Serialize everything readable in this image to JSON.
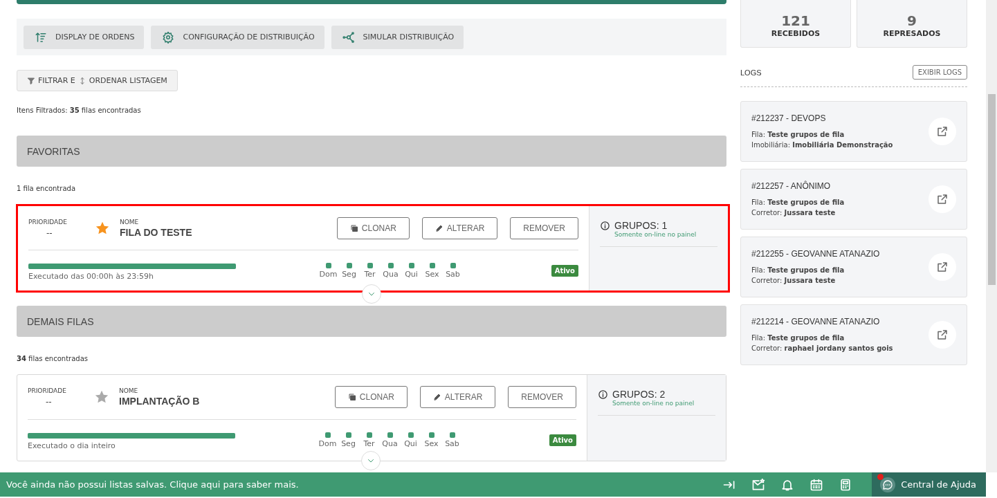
{
  "toolbar": [
    {
      "kind": "sort",
      "label": "DISPLAY DE ORDENS"
    },
    {
      "kind": "gear",
      "label": "CONFIGURAÇÃO DE DISTRIBUIÇÃO"
    },
    {
      "kind": "network",
      "label": "SIMULAR DISTRIBUIÇÃO"
    }
  ],
  "filter_button": {
    "part1": "FILTRAR E",
    "part2": "ORDENAR LISTAGEM"
  },
  "filtered_summary": "Itens Filtrados: **35** filas encontradas",
  "sections": [
    {
      "title": "FAVORITAS",
      "count_text": "1 fila encontrada",
      "queues": [
        {
          "priority_label": "PRIORIDADE",
          "priority": "--",
          "name_label": "NOME",
          "name": "FILA DO TESTE",
          "favorite": true,
          "highlighted": true,
          "actions": [
            {
              "kind": "clone",
              "label": "CLONAR"
            },
            {
              "kind": "edit",
              "label": "ALTERAR"
            },
            {
              "kind": "remove",
              "label": "REMOVER"
            }
          ],
          "level": 1,
          "schedule": "Executado das 00:00h às 23:59h",
          "days": [
            "Dom",
            "Seg",
            "Ter",
            "Qua",
            "Qui",
            "Sex",
            "Sab"
          ],
          "status": "Ativo",
          "groups": "GRUPOS: 1",
          "groups_note": "Somente on-line no painel"
        }
      ]
    },
    {
      "title": "DEMAIS FILAS",
      "count_text": "**34** filas encontradas",
      "queues": [
        {
          "priority_label": "PRIORIDADE",
          "priority": "--",
          "name_label": "NOME",
          "name": "IMPLANTAÇÃO B",
          "favorite": false,
          "highlighted": false,
          "actions": [
            {
              "kind": "clone",
              "label": "CLONAR"
            },
            {
              "kind": "edit",
              "label": "ALTERAR"
            },
            {
              "kind": "remove",
              "label": "REMOVER"
            }
          ],
          "level": 1,
          "schedule": "Executado o dia inteiro",
          "days": [
            "Dom",
            "Seg",
            "Ter",
            "Qua",
            "Qui",
            "Sex",
            "Sab"
          ],
          "status": "Ativo",
          "groups": "GRUPOS: 2",
          "groups_note": "Somente on-line no painel"
        }
      ]
    }
  ],
  "stats": [
    {
      "value": "121",
      "label": "RECEBIDOS"
    },
    {
      "value": "9",
      "label": "REPRESADOS"
    }
  ],
  "logs": {
    "title": "LOGS",
    "button": "EXIBIR LOGS",
    "items": [
      {
        "title": "#212237 - DEVOPS",
        "lines": [
          "Fila: **Teste grupos de fila**",
          "Imobiliária: **Imobiliária Demonstração**"
        ]
      },
      {
        "title": "#212257 - ANÔNIMO",
        "lines": [
          "Fila: **Teste grupos de fila**",
          "Corretor: **Jussara teste**"
        ]
      },
      {
        "title": "#212255 - GEOVANNE ATANAZIO",
        "lines": [
          "Fila: **Teste grupos de fila**",
          "Corretor: **Jussara teste**"
        ]
      },
      {
        "title": "#212214 - GEOVANNE ATANAZIO",
        "lines": [
          "Fila: **Teste grupos de fila**",
          "Corretor: **raphael jordany santos gois**"
        ]
      }
    ]
  },
  "footer": {
    "message": "Você ainda não possui listas salvas. Clique aqui para saber mais.",
    "icons": [
      {
        "kind": "arrow-to-bar"
      },
      {
        "kind": "mail-star"
      },
      {
        "kind": "bell"
      },
      {
        "kind": "calendar"
      },
      {
        "kind": "calculator"
      }
    ],
    "help": "Central de Ajuda",
    "help_notification": true
  }
}
